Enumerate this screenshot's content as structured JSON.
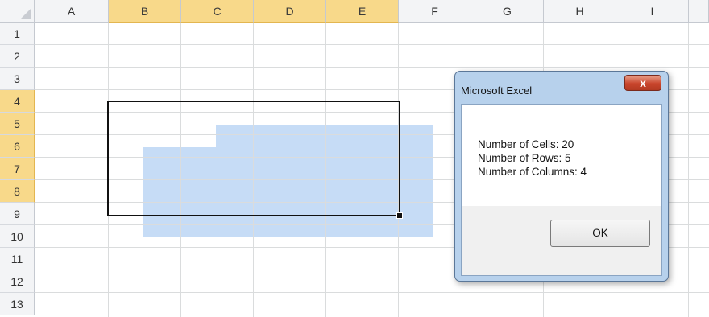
{
  "columns": [
    "A",
    "B",
    "C",
    "D",
    "E",
    "F",
    "G",
    "H",
    "I"
  ],
  "rows": [
    "1",
    "2",
    "3",
    "4",
    "5",
    "6",
    "7",
    "8",
    "9",
    "10",
    "11",
    "12",
    "13"
  ],
  "selected_columns": [
    "B",
    "C",
    "D",
    "E"
  ],
  "selected_rows": [
    "4",
    "5",
    "6",
    "7",
    "8"
  ],
  "colors": {
    "header_highlight": "#f8d98a",
    "selection_fill": "#c6dcf6",
    "close_button": "#c9452c"
  },
  "dialog": {
    "title": "Microsoft Excel",
    "close_label": "x",
    "messages": [
      "Number of Cells: 20",
      "Number of Rows: 5",
      "Number of Columns: 4"
    ],
    "ok_label": "OK"
  }
}
